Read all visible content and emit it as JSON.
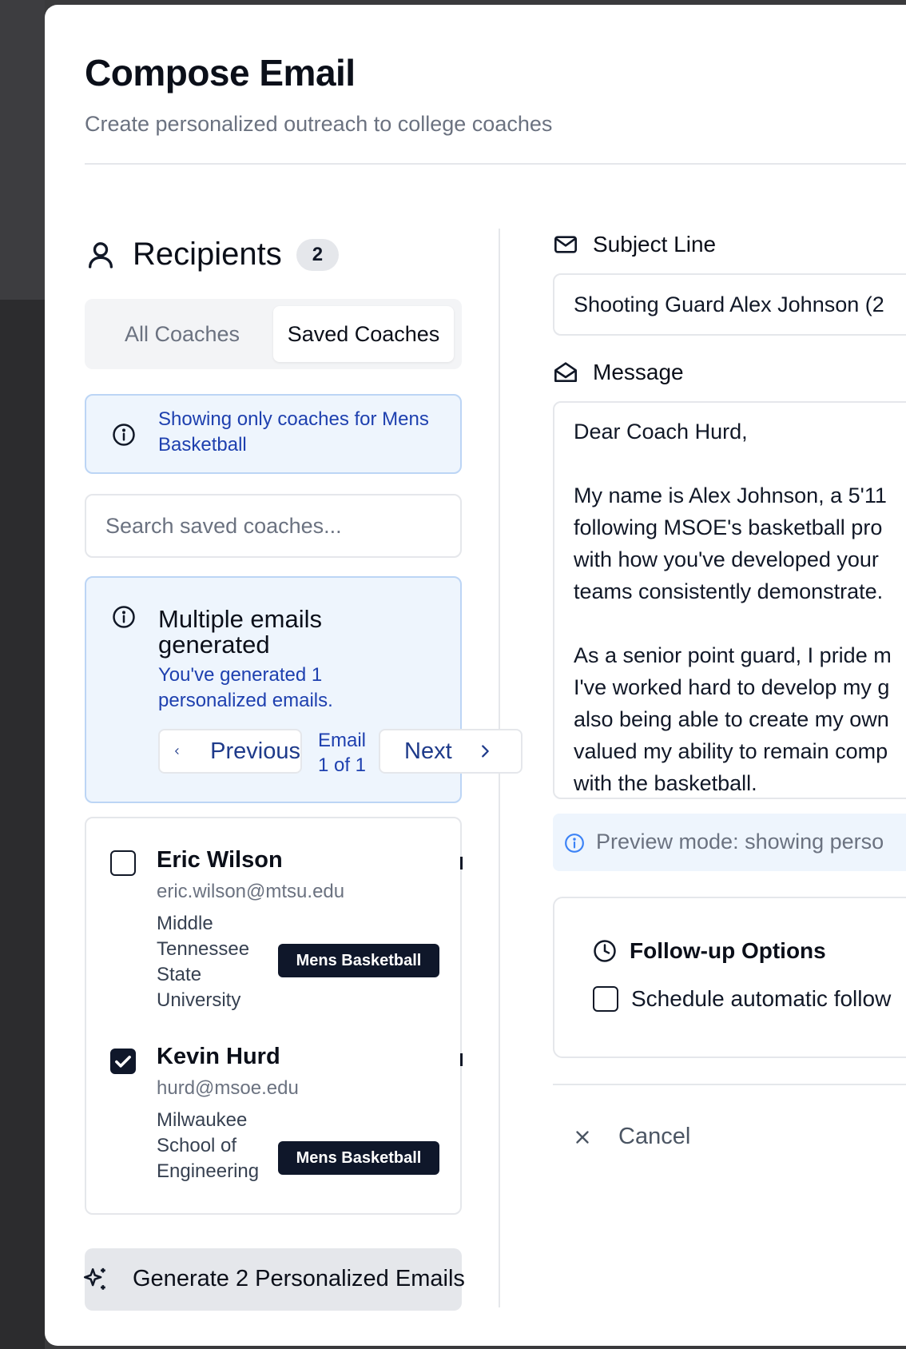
{
  "modal": {
    "title": "Compose Email",
    "subtitle": "Create personalized outreach to college coaches"
  },
  "recipients": {
    "label": "Recipients",
    "count": "2",
    "tabs": [
      "All Coaches",
      "Saved Coaches"
    ],
    "active_tab": "Saved Coaches",
    "filter_notice": "Showing only coaches for Mens Basketball",
    "search_placeholder": "Search saved coaches...",
    "multi": {
      "heading": "Multiple emails generated",
      "description": "You've generated 1 personalized emails.",
      "prev_label": "Previous",
      "next_label": "Next",
      "pager": "Email 1 of 1"
    },
    "coaches": [
      {
        "name": "Eric Wilson",
        "email": "eric.wilson@mtsu.edu",
        "school": "Middle Tennessee State University",
        "sport": "Mens Basketball",
        "checked": false
      },
      {
        "name": "Kevin Hurd",
        "email": "hurd@msoe.edu",
        "school": "Milwaukee School of Engineering",
        "sport": "Mens Basketball",
        "checked": true
      }
    ],
    "generate_label": "Generate 2 Personalized Emails"
  },
  "compose": {
    "subject_label": "Subject Line",
    "subject_value": "Shooting Guard Alex Johnson (2",
    "message_label": "Message",
    "message_lines": [
      "Dear Coach Hurd,",
      "",
      "My name is Alex Johnson, a 5'11",
      "following MSOE's basketball pro",
      "with how you've developed your",
      "teams consistently demonstrate.",
      "",
      "As a senior point guard, I pride m",
      "I've worked hard to develop my g",
      "also being able to create my own",
      "valued my ability to remain comp",
      "with the basketball."
    ],
    "preview_notice": "Preview mode: showing perso",
    "followup_heading": "Follow-up Options",
    "followup_option": "Schedule automatic follow",
    "cancel_label": "Cancel"
  },
  "icons": {
    "user": "user-icon",
    "info": "info-icon",
    "mail": "mail-icon",
    "mail_open": "mail-open-icon",
    "clock": "clock-icon",
    "sparkles": "sparkles-icon",
    "close": "close-icon"
  }
}
